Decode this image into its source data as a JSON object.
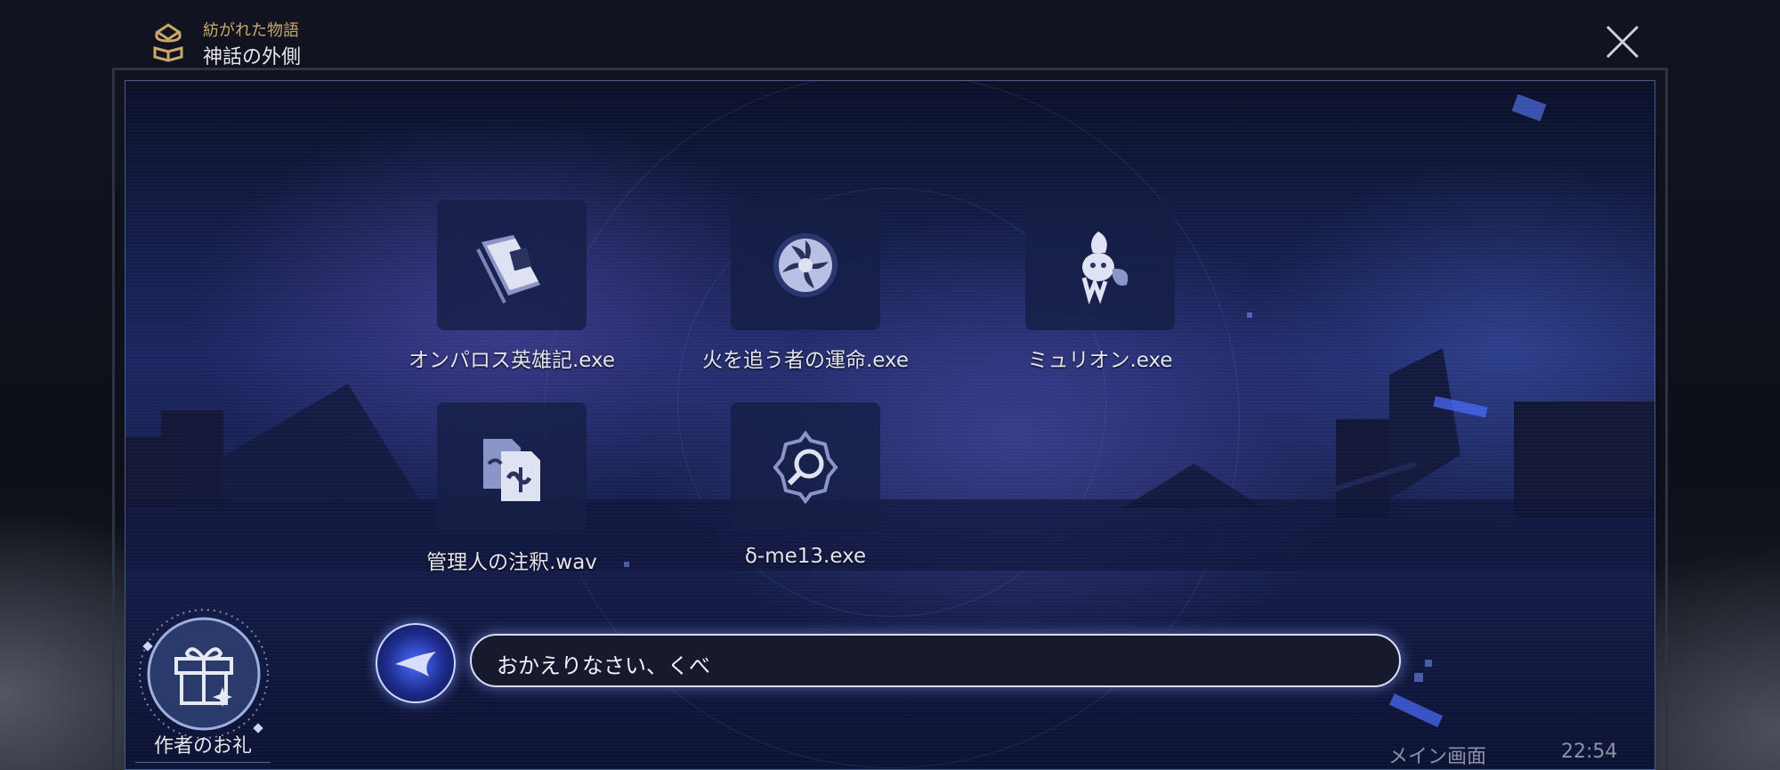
{
  "header": {
    "subtitle": "紡がれた物語",
    "title": "神話の外側"
  },
  "apps": [
    {
      "label": "オンパロス英雄記.exe",
      "icon": "book-icon"
    },
    {
      "label": "火を追う者の運命.exe",
      "icon": "vortex-icon"
    },
    {
      "label": "ミュリオン.exe",
      "icon": "creature-icon"
    },
    {
      "label": "管理人の注釈.wav",
      "icon": "documents-icon"
    },
    {
      "label": "δ-me13.exe",
      "icon": "magnifier-icon"
    }
  ],
  "dialogue": {
    "text": "おかえりなさい、くべ"
  },
  "gift": {
    "label": "作者のお礼"
  },
  "footer": {
    "nav_label": "メイン画面",
    "time": "22:54"
  },
  "colors": {
    "accent_gold": "#c9a86a",
    "screen_blue": "#1b2660",
    "bubble_border": "#d8defa"
  }
}
